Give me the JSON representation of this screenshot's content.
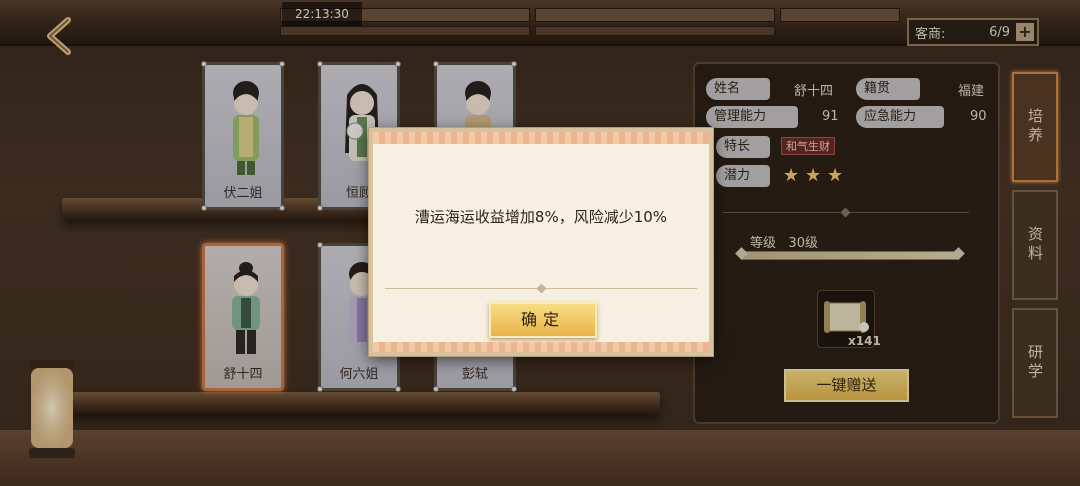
{
  "status": {
    "clock": "22:13:30"
  },
  "header": {
    "guest_label": "客商:",
    "guest_count": "6/9",
    "add_glyph": "+"
  },
  "cards": [
    {
      "name": "伏二姐",
      "selected": false
    },
    {
      "name": "恒顾",
      "selected": false
    },
    {
      "name": "",
      "selected": false
    },
    {
      "name": "舒十四",
      "selected": true
    },
    {
      "name": "何六姐",
      "selected": false
    },
    {
      "name": "彭轼",
      "selected": false
    }
  ],
  "info": {
    "name_label": "姓名",
    "name_value": "舒十四",
    "origin_label": "籍贯",
    "origin_value": "福建",
    "manage_label": "管理能力",
    "manage_value": "91",
    "emergency_label": "应急能力",
    "emergency_value": "90",
    "specialty_label": "特长",
    "specialty_value": "和气生财",
    "potential_label": "潜力",
    "potential_stars": 3,
    "level_label": "等级",
    "level_value": "30级",
    "level_fill": 1.0,
    "item_count": "x141",
    "gift_button": "一键赠送"
  },
  "side_tabs": [
    {
      "label": "培养",
      "active": true
    },
    {
      "label": "资料",
      "active": false
    },
    {
      "label": "研学",
      "active": false
    }
  ],
  "dialog": {
    "message": "漕运海运收益增加8%，风险减少10%",
    "confirm": "确定"
  },
  "colors": {
    "accent_gold": "#e8b44a",
    "selected_border": "#d07a45",
    "star": "#f3cc6e"
  }
}
